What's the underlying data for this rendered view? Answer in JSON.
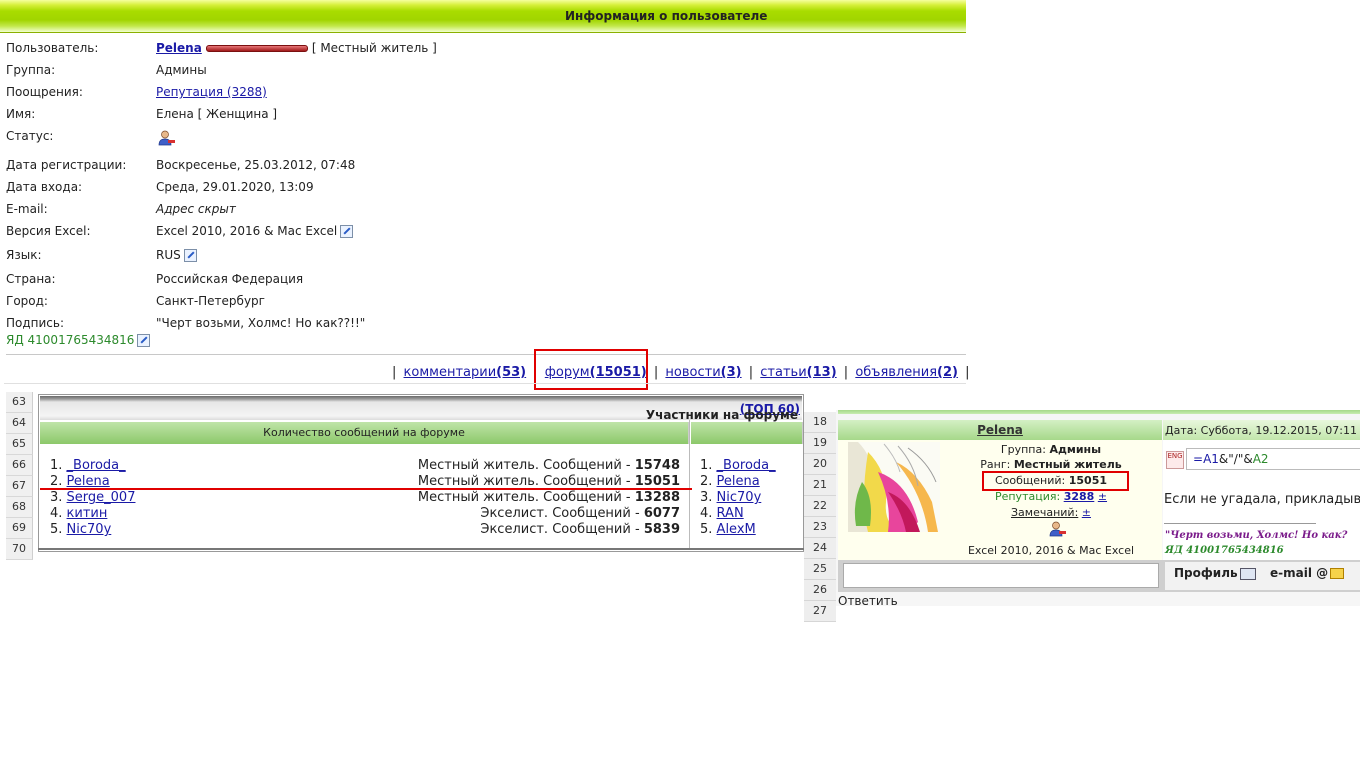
{
  "header": {
    "title": "Информация о пользователе"
  },
  "profile": {
    "user_label": "Пользователь:",
    "user_name": "Pelena",
    "user_rank": "[ Местный житель ]",
    "group_label": "Группа:",
    "group_value": "Админы",
    "rewards_label": "Поощрения:",
    "rewards_value": "Репутация (3288)",
    "name_label": "Имя:",
    "name_value": "Елена [ Женщина ]",
    "status_label": "Статус:",
    "reg_label": "Дата регистрации:",
    "reg_value": "Воскресенье, 25.03.2012, 07:48",
    "login_label": "Дата входа:",
    "login_value": "Среда, 29.01.2020, 13:09",
    "email_label": "E-mail:",
    "email_value": "Адрес скрыт",
    "excel_label": "Версия Excel:",
    "excel_value": "Excel 2010, 2016 & Mac Excel",
    "lang_label": "Язык:",
    "lang_value": "RUS",
    "country_label": "Страна:",
    "country_value": "Российская Федерация",
    "city_label": "Город:",
    "city_value": "Санкт-Петербург",
    "sig_label": "Подпись:",
    "sig_value": "\"Черт возьми, Холмс! Но как??!!\"",
    "yd_value": "ЯД 41001765434816"
  },
  "nav": {
    "comments_text": "комментарии",
    "comments_count": "(53)",
    "forum_text": "форум",
    "forum_count": "(15051)",
    "news_text": "новости",
    "news_count": "(3)",
    "articles_text": "статьи",
    "articles_count": "(13)",
    "ads_text": "объявления",
    "ads_count": "(2)",
    "sep": "|"
  },
  "forum_table": {
    "row_numbers": [
      "63",
      "64",
      "65",
      "66",
      "67",
      "68",
      "69",
      "70"
    ],
    "title": "Участники на форуме",
    "title_link": "(ТОП 60)",
    "left_header": "Количество сообщений на форуме",
    "left_rows": [
      {
        "num": "1.",
        "name": "_Boroda_",
        "status": "Местный житель. Сообщений -",
        "count": "15748"
      },
      {
        "num": "2.",
        "name": "Pelena",
        "status": "Местный житель. Сообщений -",
        "count": "15051"
      },
      {
        "num": "3.",
        "name": "Serge_007",
        "status": "Местный житель. Сообщений -",
        "count": "13288"
      },
      {
        "num": "4.",
        "name": "китин",
        "status": "Экселист. Сообщений -",
        "count": "6077"
      },
      {
        "num": "5.",
        "name": "Nic70y",
        "status": "Экселист. Сообщений -",
        "count": "5839"
      }
    ],
    "right_rows": [
      {
        "num": "1.",
        "name": "_Boroda_"
      },
      {
        "num": "2.",
        "name": "Pelena"
      },
      {
        "num": "3.",
        "name": "Nic70y"
      },
      {
        "num": "4.",
        "name": "RAN"
      },
      {
        "num": "5.",
        "name": "AlexM"
      }
    ]
  },
  "post": {
    "row_numbers": [
      "18",
      "19",
      "20",
      "21",
      "22",
      "23",
      "24",
      "25",
      "26",
      "27"
    ],
    "author": "Pelena",
    "date": "Дата: Суббота, 19.12.2015, 07:11",
    "group_label": "Группа:",
    "group_value": "Админы",
    "rank_label": "Ранг:",
    "rank_value": "Местный житель",
    "messages_label": "Сообщений:",
    "messages_value": "15051",
    "rep_label": "Репутация:",
    "rep_value": "3288",
    "rep_pm": "±",
    "warn_label": "Замечаний:",
    "warn_pm": "±",
    "excel": "Excel 2010, 2016 & Mac Excel",
    "formula_prefix": "=",
    "formula_a1": "A1",
    "formula_mid": "&\"/\"&",
    "formula_a2": "A2",
    "fx_label": "ENG",
    "text": "Если не угадала, прикладыв",
    "signature": "\"Черт возьми, Холмс! Но как?",
    "yd": "ЯД 41001765434816",
    "profile_btn": "Профиль",
    "email_btn": "e-mail",
    "email_at": "@",
    "reply": "Ответить"
  }
}
